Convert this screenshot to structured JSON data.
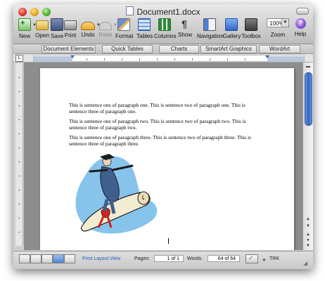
{
  "window": {
    "title": "Document1.docx"
  },
  "toolbar": {
    "new": "New",
    "open": "Open",
    "save": "Save",
    "print": "Print",
    "undo": "Undo",
    "redo": "Redo",
    "format": "Format",
    "tables": "Tables",
    "columns": "Columns",
    "show": "Show",
    "navigation": "Navigation",
    "gallery": "Gallery",
    "toolbox": "Toolbox",
    "zoom_label": "Zoom",
    "zoom_value": "100%",
    "help": "Help",
    "show_glyph": "¶",
    "help_glyph": "?"
  },
  "elements_gallery": {
    "tabs": [
      "Document Elements",
      "Quick Tables",
      "Charts",
      "SmartArt Graphics",
      "WordArt"
    ]
  },
  "document": {
    "paragraphs": [
      "This is sentence one of paragraph one. This is sentence two of paragraph one. This is sentence three of paragraph one.",
      "This is sentence one of paragraph two. This is sentence two of paragraph two. This is sentence three of paragraph two.",
      "This is sentence one of paragraph three. This is sentence two of paragraph three. This is sentence three of paragraph three."
    ],
    "image": "clip-art graduate surfing on rolled diploma"
  },
  "status_bar": {
    "view_label": "Print Layout View",
    "pages_label": "Pages:",
    "pages_value": "1 of 1",
    "words_label": "Words:",
    "words_value": "64 of 64",
    "track_label": "TRK"
  },
  "colors": {
    "accent_blue": "#2f62c6",
    "clipart_blue": "#86c4ec",
    "ribbon_red": "#d2231f"
  }
}
